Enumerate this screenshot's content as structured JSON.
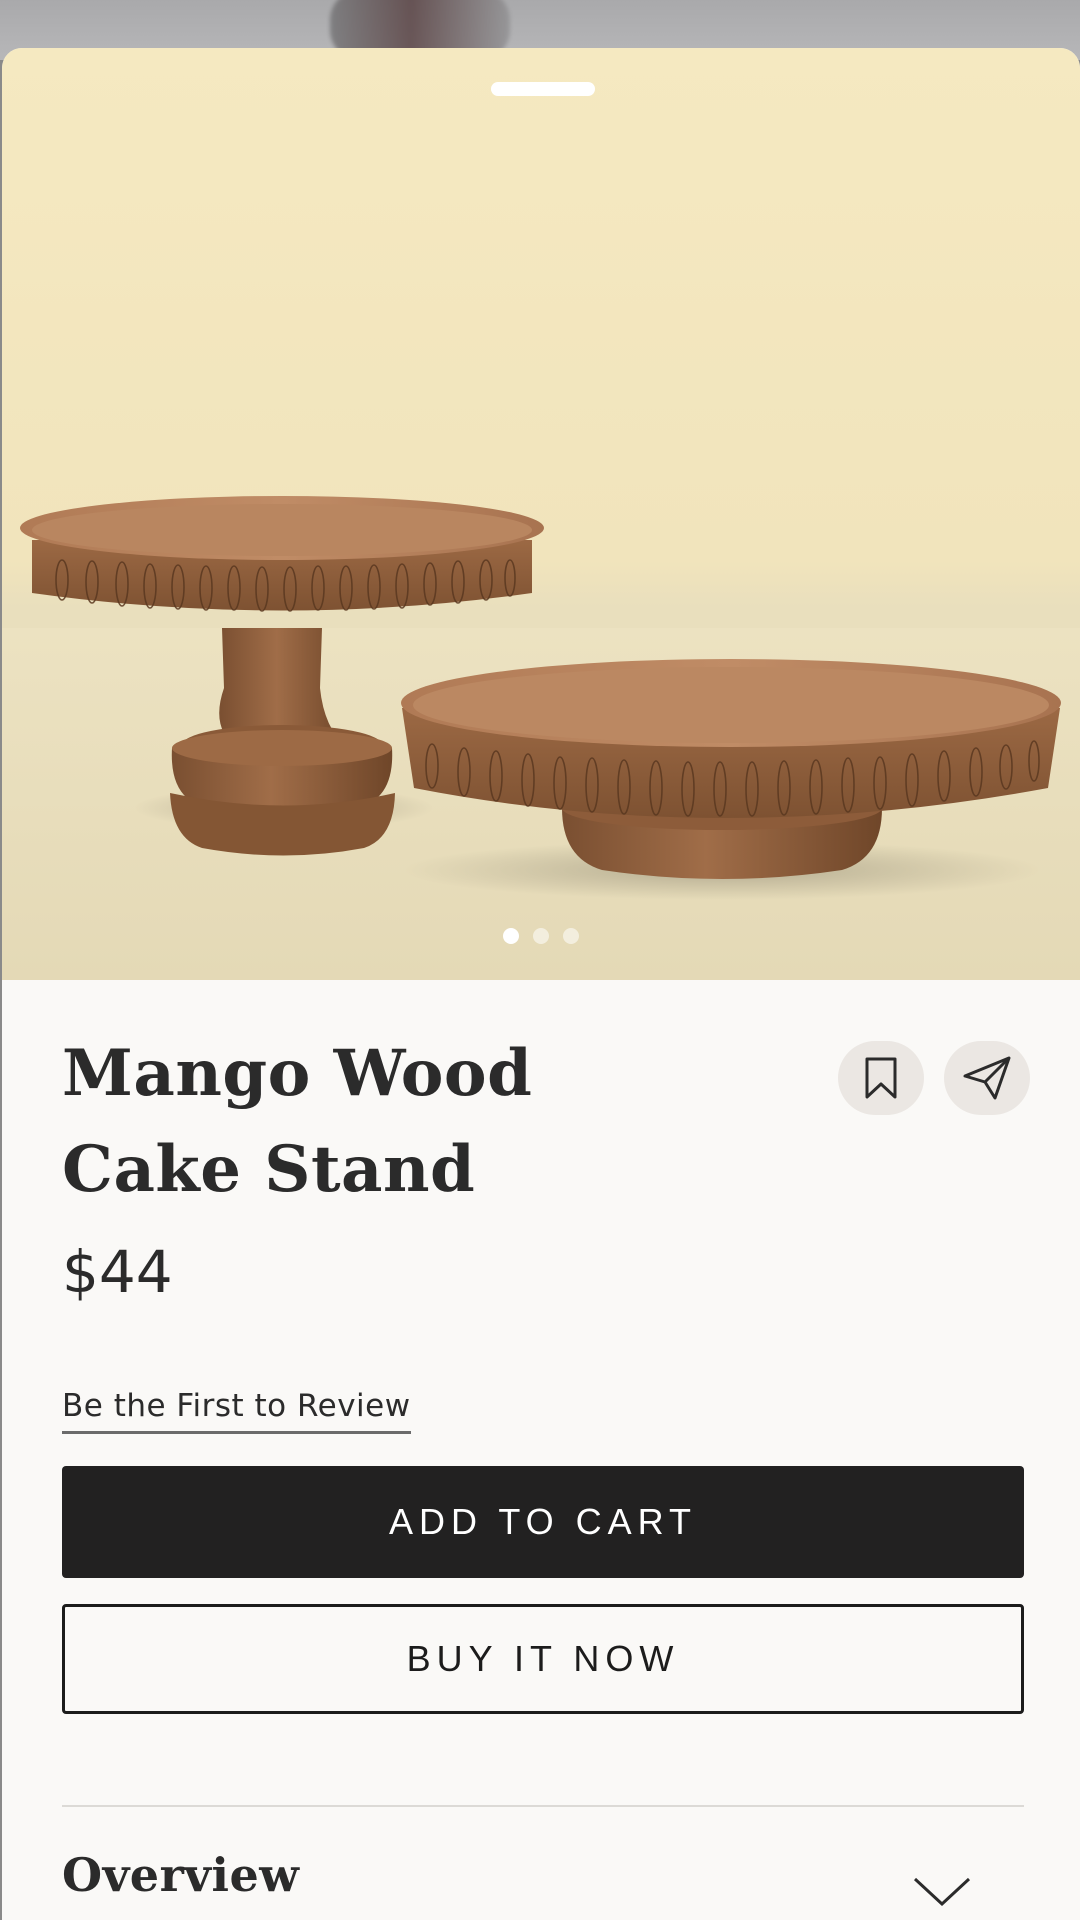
{
  "product": {
    "title": "Mango Wood Cake Stand",
    "price": "$44",
    "review_link": "Be the First to Review",
    "image_alt": "Two mango wood cake stands on a cream background"
  },
  "gallery": {
    "image_count": 3,
    "active_index": 0
  },
  "actions": {
    "add_to_cart": "ADD TO CART",
    "buy_now": "BUY IT NOW",
    "save_icon": "bookmark-icon",
    "share_icon": "send-icon"
  },
  "sections": {
    "overview": "Overview"
  },
  "colors": {
    "primary_button": "#222121",
    "background": "#faf9f7",
    "hero_background": "#f3e7bf",
    "icon_button": "#ebe7e3"
  }
}
